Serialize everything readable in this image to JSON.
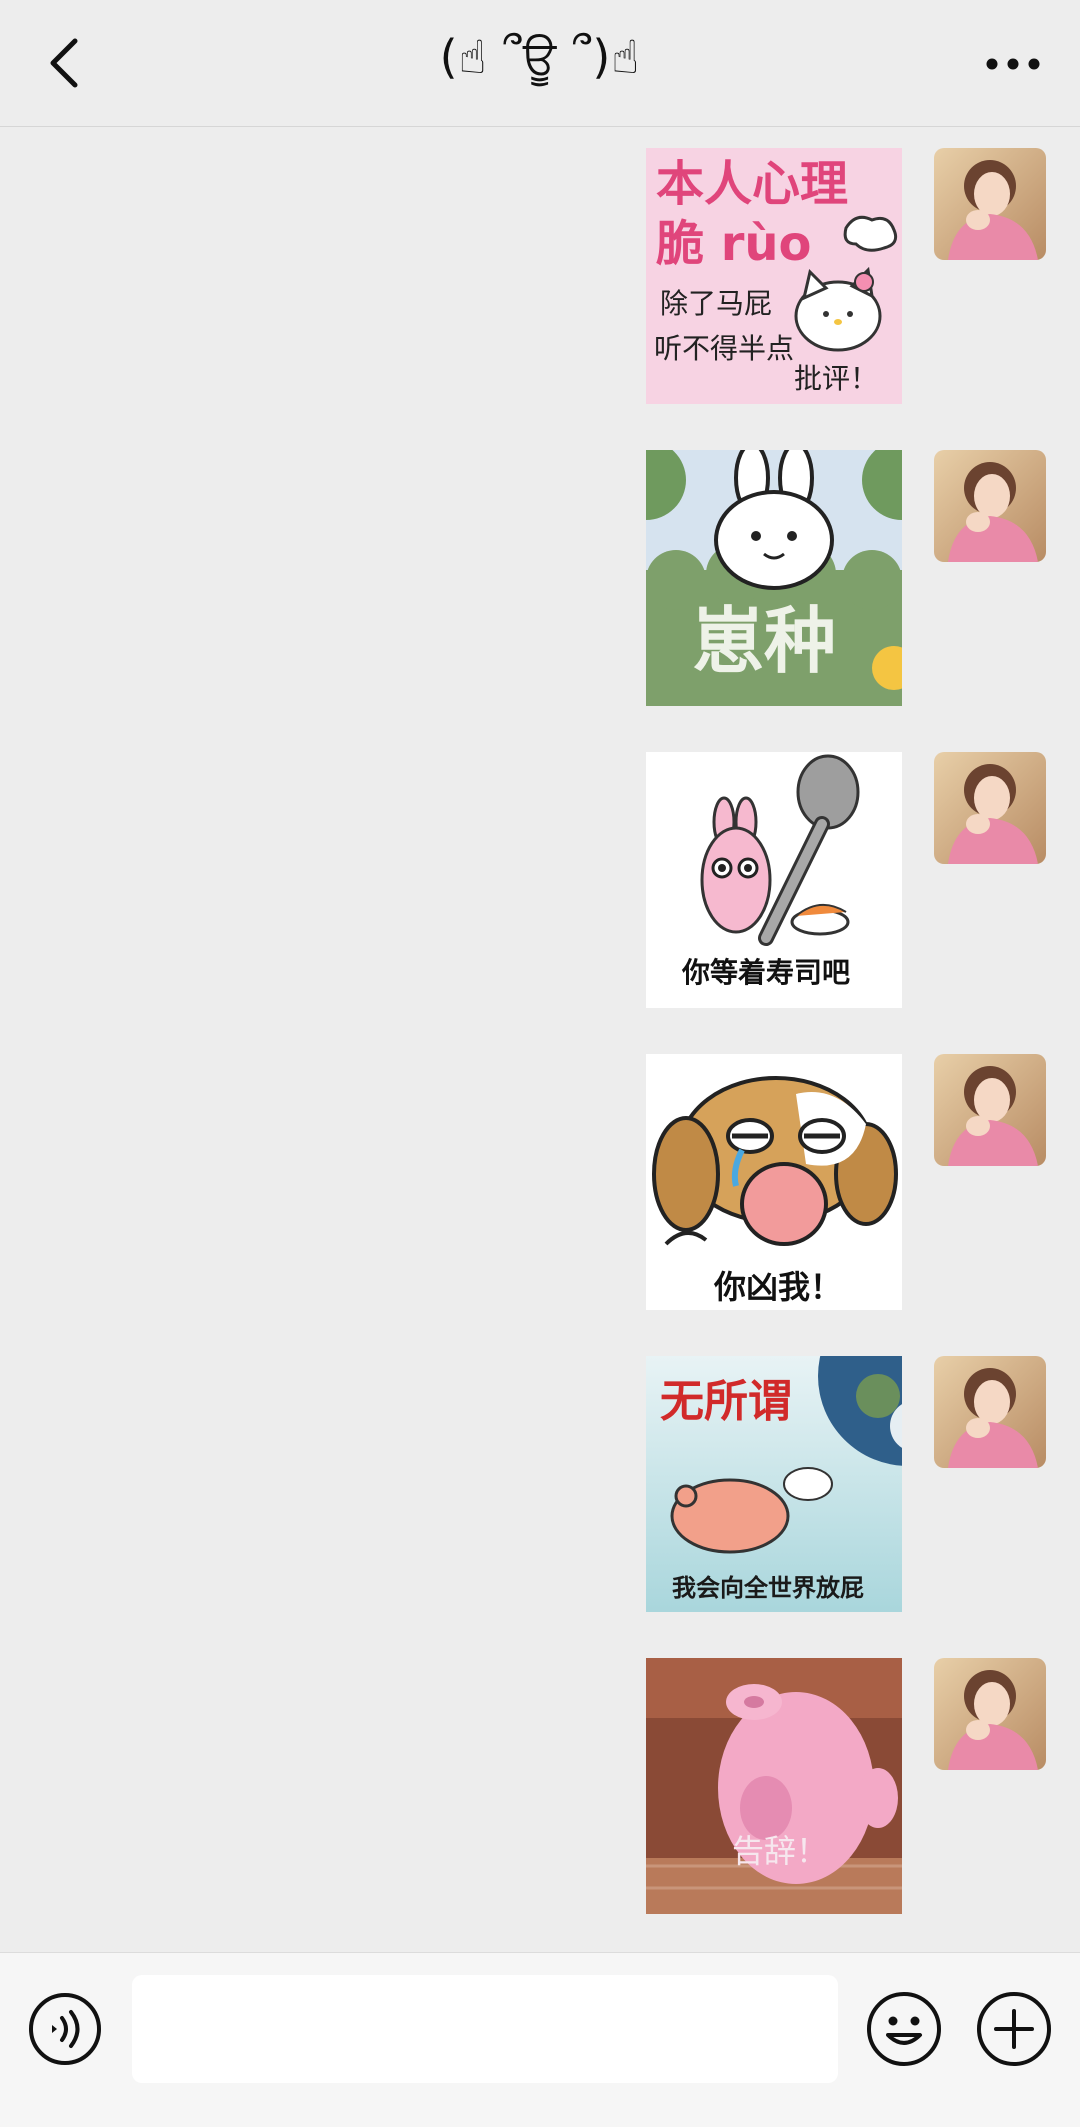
{
  "header": {
    "title": "(☝ ՞ਊ ՞)☝",
    "back_icon": "chevron-left-icon",
    "more_icon": "more-dots-icon"
  },
  "messages": [
    {
      "sender": "self",
      "type": "sticker",
      "sticker": "hello-kitty-sticker",
      "lines": [
        "本人心理",
        "脆 rùo",
        "除了马屁",
        "听不得半点",
        "批评！"
      ]
    },
    {
      "sender": "self",
      "type": "sticker",
      "sticker": "bunny-bush-sticker",
      "lines": [
        "崽种"
      ]
    },
    {
      "sender": "self",
      "type": "sticker",
      "sticker": "rabbit-spoon-sushi-sticker",
      "lines": [
        "你等着寿司吧"
      ]
    },
    {
      "sender": "self",
      "type": "sticker",
      "sticker": "crying-dog-sticker",
      "lines": [
        "你凶我！"
      ]
    },
    {
      "sender": "self",
      "type": "sticker",
      "sticker": "pig-earth-sticker",
      "lines": [
        "无所谓",
        "我会向全世界放屁"
      ]
    },
    {
      "sender": "self",
      "type": "sticker",
      "sticker": "pink-pig-leaving-sticker",
      "lines": [
        "告辞！"
      ]
    }
  ],
  "input_bar": {
    "voice_icon": "voice-icon",
    "input_value": "",
    "emoji_icon": "emoji-icon",
    "plus_icon": "plus-icon"
  },
  "colors": {
    "background": "#ededed",
    "header_bg": "#ededed",
    "input_bar_bg": "#f6f6f6",
    "pink_text": "#e0457b"
  }
}
